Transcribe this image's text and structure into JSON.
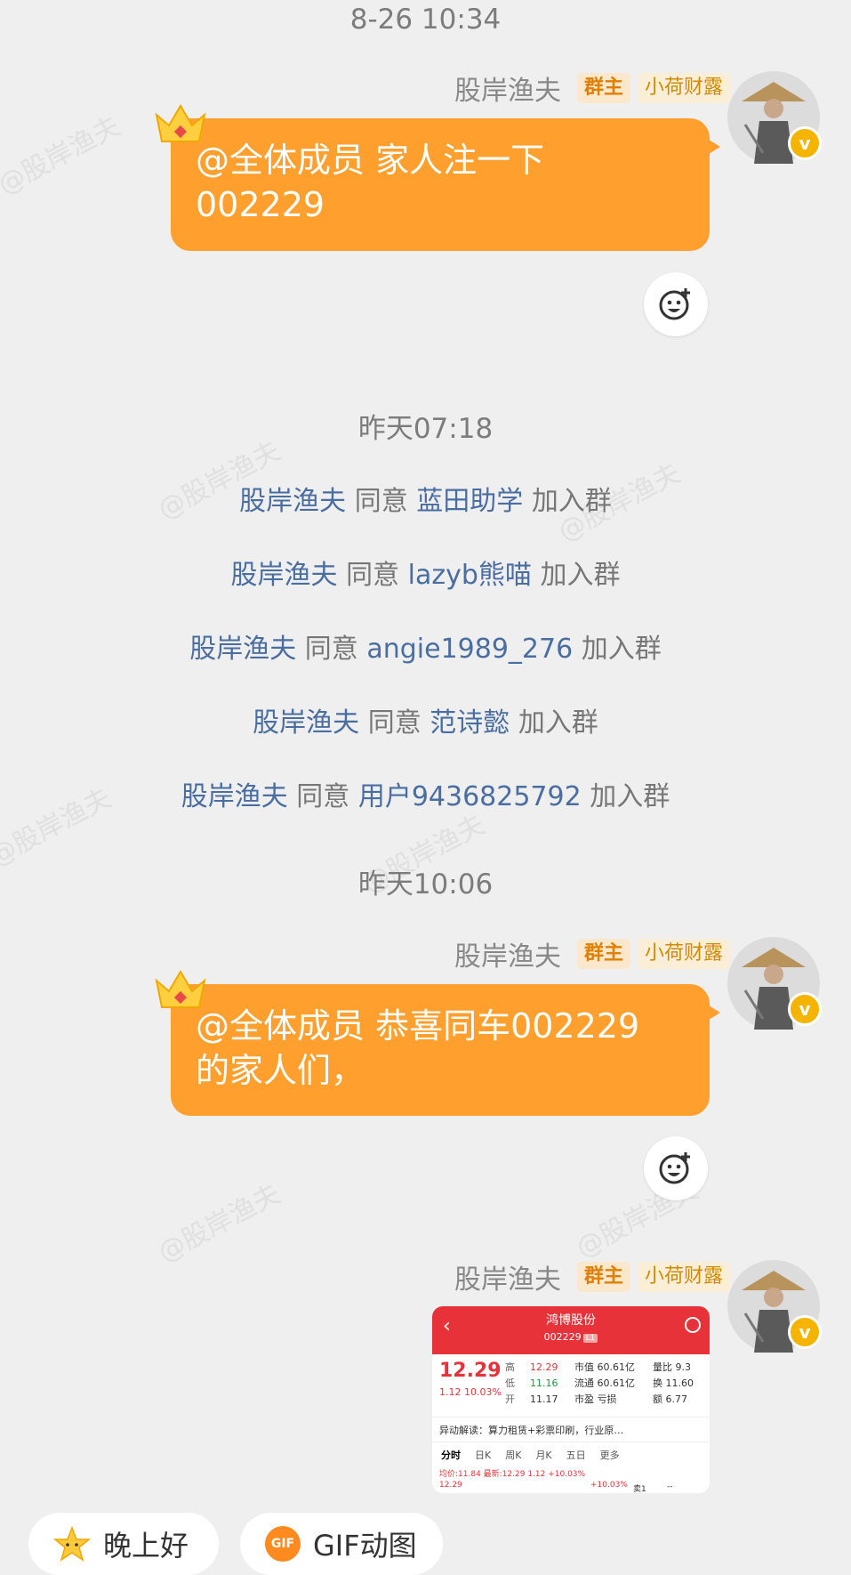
{
  "colors": {
    "bubble": "#ff9f2e",
    "link_name": "#4a6ea1",
    "system_text": "#777777",
    "badge_owner": "#e17f00",
    "stock_red": "#e8323a"
  },
  "timestamps": [
    "8-26 10:34",
    "昨天07:18",
    "昨天10:06"
  ],
  "sender": {
    "name": "股岸渔夫",
    "badge_owner": "群主",
    "badge_title": "小荷财露",
    "avatar_icon": "fisherman-avatar",
    "verified_label": "v"
  },
  "messages": [
    {
      "line1": "@全体成员 家人注一下",
      "line2": "002229"
    },
    {
      "line1": "@全体成员 恭喜同车002229",
      "line2": "的家人们，"
    }
  ],
  "system_messages": [
    {
      "actor": "股岸渔夫",
      "verb": "同意",
      "target": "蓝田助学",
      "action": "加入群"
    },
    {
      "actor": "股岸渔夫",
      "verb": "同意",
      "target": "lazyb熊喵",
      "action": "加入群"
    },
    {
      "actor": "股岸渔夫",
      "verb": "同意",
      "target": "angie1989_276",
      "action": "加入群"
    },
    {
      "actor": "股岸渔夫",
      "verb": "同意",
      "target": "范诗懿",
      "action": "加入群"
    },
    {
      "actor": "股岸渔夫",
      "verb": "同意",
      "target": "用户9436825792",
      "action": "加入群"
    }
  ],
  "stock": {
    "name": "鸿博股份",
    "code": "002229",
    "price": "12.29",
    "change": "1.12",
    "change_pct": "10.03%",
    "high_label": "高",
    "high": "12.29",
    "low_label": "低",
    "low": "11.16",
    "open_label": "开",
    "open": "11.17",
    "mcap_label": "市值",
    "mcap": "60.61亿",
    "float_label": "流通",
    "float": "60.61亿",
    "pe_label": "市盈",
    "pe": "亏损",
    "ratio_label": "量比",
    "ratio": "9.3",
    "turnover_label": "换",
    "turnover": "11.60",
    "amount_label": "额",
    "amount": "6.77",
    "news": "异动解读：算力租赁+彩票印刷，行业原…",
    "tabs": [
      "分时",
      "日K",
      "周K",
      "月K",
      "五日",
      "更多"
    ],
    "avg_line": "均价:11.84  最新:12.29  1.12  +10.03%",
    "axis_left": "12.29",
    "axis_right": "+10.03%",
    "sell_label": "卖1",
    "sell_value": "--"
  },
  "quick_replies": [
    {
      "label": "晚上好",
      "icon": "star-emoji-icon"
    },
    {
      "label": "GIF动图",
      "icon": "gif-icon",
      "icon_text": "GIF"
    }
  ],
  "watermark": "@股岸渔夫"
}
